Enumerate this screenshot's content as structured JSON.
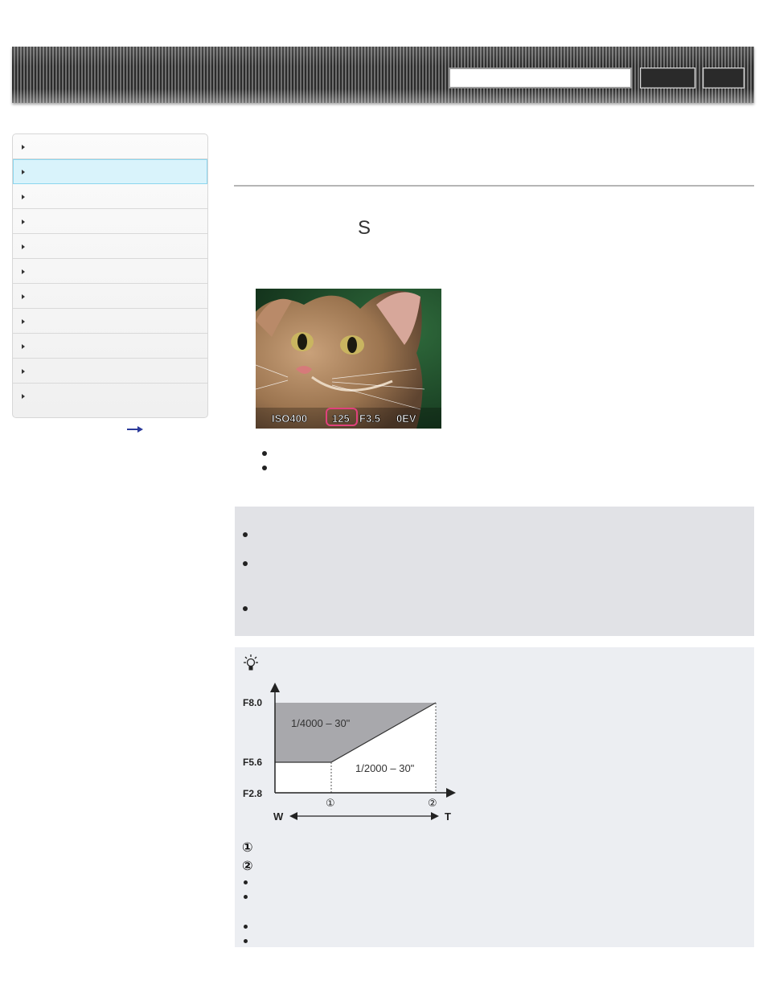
{
  "header": {
    "search_placeholder": "",
    "search_button_label": "",
    "print_button_label": ""
  },
  "sidebar": {
    "item_count": 11,
    "active_index": 1
  },
  "main": {
    "mode_letter": "S",
    "photo_overlay": {
      "iso": "ISO400",
      "shutter": "125",
      "aperture": "F3.5",
      "ev": "0EV"
    }
  },
  "chart_data": {
    "type": "area",
    "title": "",
    "xlabel": "",
    "ylabel": "",
    "x_labels": [
      "W",
      "T"
    ],
    "y_ticks": [
      "F8.0",
      "F5.6",
      "F2.8"
    ],
    "zoom_markers": [
      "①",
      "②"
    ],
    "regions": [
      {
        "name": "1/4000 – 30\"",
        "color": "#a8a8ac"
      },
      {
        "name": "1/2000 – 30\"",
        "color": "#ffffff"
      }
    ],
    "boundary": [
      {
        "zoom": "W",
        "aperture": "F5.6"
      },
      {
        "zoom": "①",
        "aperture": "F5.6"
      },
      {
        "zoom": "②",
        "aperture": "F8.0"
      }
    ]
  },
  "hint": {
    "marker_1": "①",
    "marker_2": "②"
  }
}
